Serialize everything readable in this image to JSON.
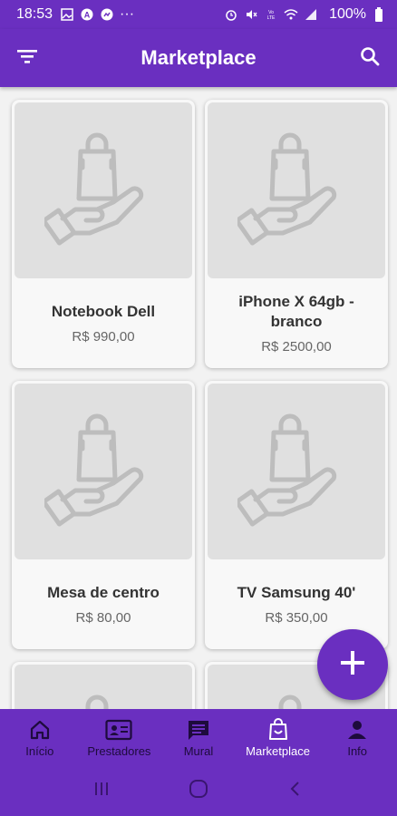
{
  "status_bar": {
    "time": "18:53",
    "dots": "···",
    "battery": "100%"
  },
  "app_bar": {
    "title": "Marketplace",
    "filter_icon": "filter-icon",
    "search_icon": "search-icon"
  },
  "products": [
    {
      "name": "Notebook Dell",
      "price": "R$ 990,00"
    },
    {
      "name": "iPhone X 64gb - branco",
      "price": "R$ 2500,00"
    },
    {
      "name": "Mesa de centro",
      "price": "R$ 80,00"
    },
    {
      "name": "TV Samsung 40'",
      "price": "R$ 350,00"
    }
  ],
  "nav": {
    "items": [
      {
        "label": "Início",
        "icon": "home-icon"
      },
      {
        "label": "Prestadores",
        "icon": "contact-card-icon"
      },
      {
        "label": "Mural",
        "icon": "message-board-icon"
      },
      {
        "label": "Marketplace",
        "icon": "shopping-bag-icon"
      },
      {
        "label": "Info",
        "icon": "person-icon"
      }
    ],
    "active_index": 3
  },
  "colors": {
    "primary": "#6a2fc0",
    "placeholder_bg": "#e0e0e0",
    "placeholder_icon": "#bdbdbd"
  }
}
